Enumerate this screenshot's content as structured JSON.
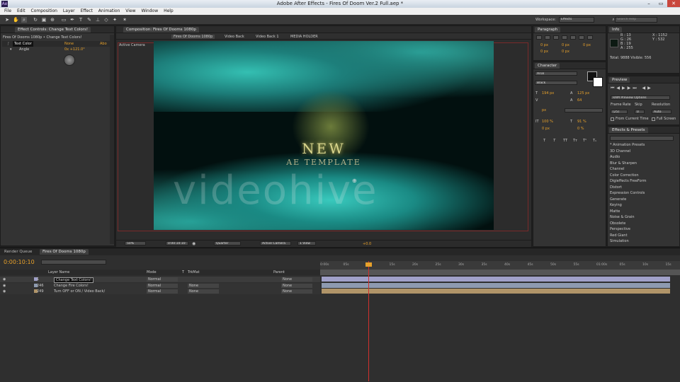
{
  "window": {
    "app_icon": "Ae",
    "title": "Adobe After Effects - Fires Of Doom Ver.2 Full.aep *",
    "controls": [
      "–",
      "▭",
      "✕"
    ]
  },
  "menu": [
    "File",
    "Edit",
    "Composition",
    "Layer",
    "Effect",
    "Animation",
    "View",
    "Window",
    "Help"
  ],
  "workspace": {
    "label": "Workspace:",
    "value": "Effects",
    "search_placeholder": "Search Help"
  },
  "effect_controls": {
    "tab": "Effect Controls: Change Text Colors!",
    "breadcrumb": "Fires Of Dooms 1080p • Change Text Colors!",
    "effect_name": "Text Color",
    "effect_reset": "Abo",
    "prop_name": "Angle",
    "value_top": "None",
    "value": "0x +121.0°"
  },
  "composition": {
    "tab": "Composition: Fires Of Dooms 1080p",
    "breadcrumbs": [
      "Fires Of Dooms 1080p",
      "Video Back",
      "Video Back 1",
      "MEDIA HOLDER"
    ],
    "camera_label": "Active Camera",
    "title_line1": "NEW",
    "title_line2": "AE TEMPLATE",
    "watermark": "videohive",
    "footer": {
      "zoom": "50%",
      "timecode": "0:00:10:10",
      "resolution": "Quarter",
      "camera": "Active Camera",
      "view": "1 View",
      "offset": "+0.0"
    }
  },
  "paragraph": {
    "tab": "Paragraph",
    "values": [
      "0 px",
      "0 px",
      "0 px",
      "0 px",
      "0 px"
    ]
  },
  "character": {
    "tab": "Character",
    "font": "Arial",
    "style": "Black",
    "size": "194 px",
    "leading": "125 px",
    "kerning": "",
    "tracking": "64",
    "stroke_unit": "px",
    "vscale": "100 %",
    "hscale": "91 %",
    "baseline": "0 px",
    "tsume": "0 %",
    "styles": [
      "T",
      "T",
      "TT",
      "Tт",
      "T¹",
      "T₁"
    ]
  },
  "info": {
    "tab": "Info",
    "r": "R : 13",
    "g": "G : 26",
    "b": "B : 19",
    "a": "A : 255",
    "x": "X : 1152",
    "y": "Y : 532",
    "total": "Total: 9888  Visible: 556"
  },
  "preview": {
    "tab": "Preview",
    "ram": "RAM Preview Options",
    "labels": [
      "Frame Rate",
      "Skip",
      "Resolution"
    ],
    "values": [
      "(25)",
      "0",
      "Auto"
    ],
    "from_current": "From Current Time",
    "full_screen": "Full Screen"
  },
  "effects_presets": {
    "tab": "Effects & Presets",
    "items": [
      "* Animation Presets",
      "3D Channel",
      "Audio",
      "Blur & Sharpen",
      "Channel",
      "Color Correction",
      "Digieffects FreeForm",
      "Distort",
      "Expression Controls",
      "Generate",
      "Keying",
      "Matte",
      "Noise & Grain",
      "Obsolete",
      "Perspective",
      "Red Giant",
      "Simulation"
    ]
  },
  "timeline": {
    "tabs": [
      "Render Queue",
      "Fires Of Dooms 1080p"
    ],
    "timecode": "0:00:10:10",
    "search_placeholder": "",
    "columns": {
      "name": "Layer Name",
      "mode": "Mode",
      "t": "T",
      "trkmat": "TrkMat",
      "parent": "Parent"
    },
    "layers": [
      {
        "num": "1",
        "name": "Change Text Colors!",
        "mode": "Normal",
        "trkmat": "",
        "parent": "None",
        "color": "#a0a0c8"
      },
      {
        "num": "246",
        "name": "Change Fire Colors!",
        "mode": "Normal",
        "trkmat": "None",
        "parent": "None",
        "color": "#8e9ab0"
      },
      {
        "num": "249",
        "name": "Turn OFF or ON / Video Back/",
        "mode": "Normal",
        "trkmat": "None",
        "parent": "None",
        "color": "#b09468"
      }
    ],
    "ruler": [
      "0:00s",
      "05s",
      "10s",
      "15s",
      "20s",
      "25s",
      "30s",
      "35s",
      "40s",
      "45s",
      "50s",
      "55s",
      "01:00s",
      "05s",
      "10s",
      "15s"
    ]
  },
  "colors": {
    "accent": "#e7a12b",
    "playhead": "#d0312d"
  }
}
